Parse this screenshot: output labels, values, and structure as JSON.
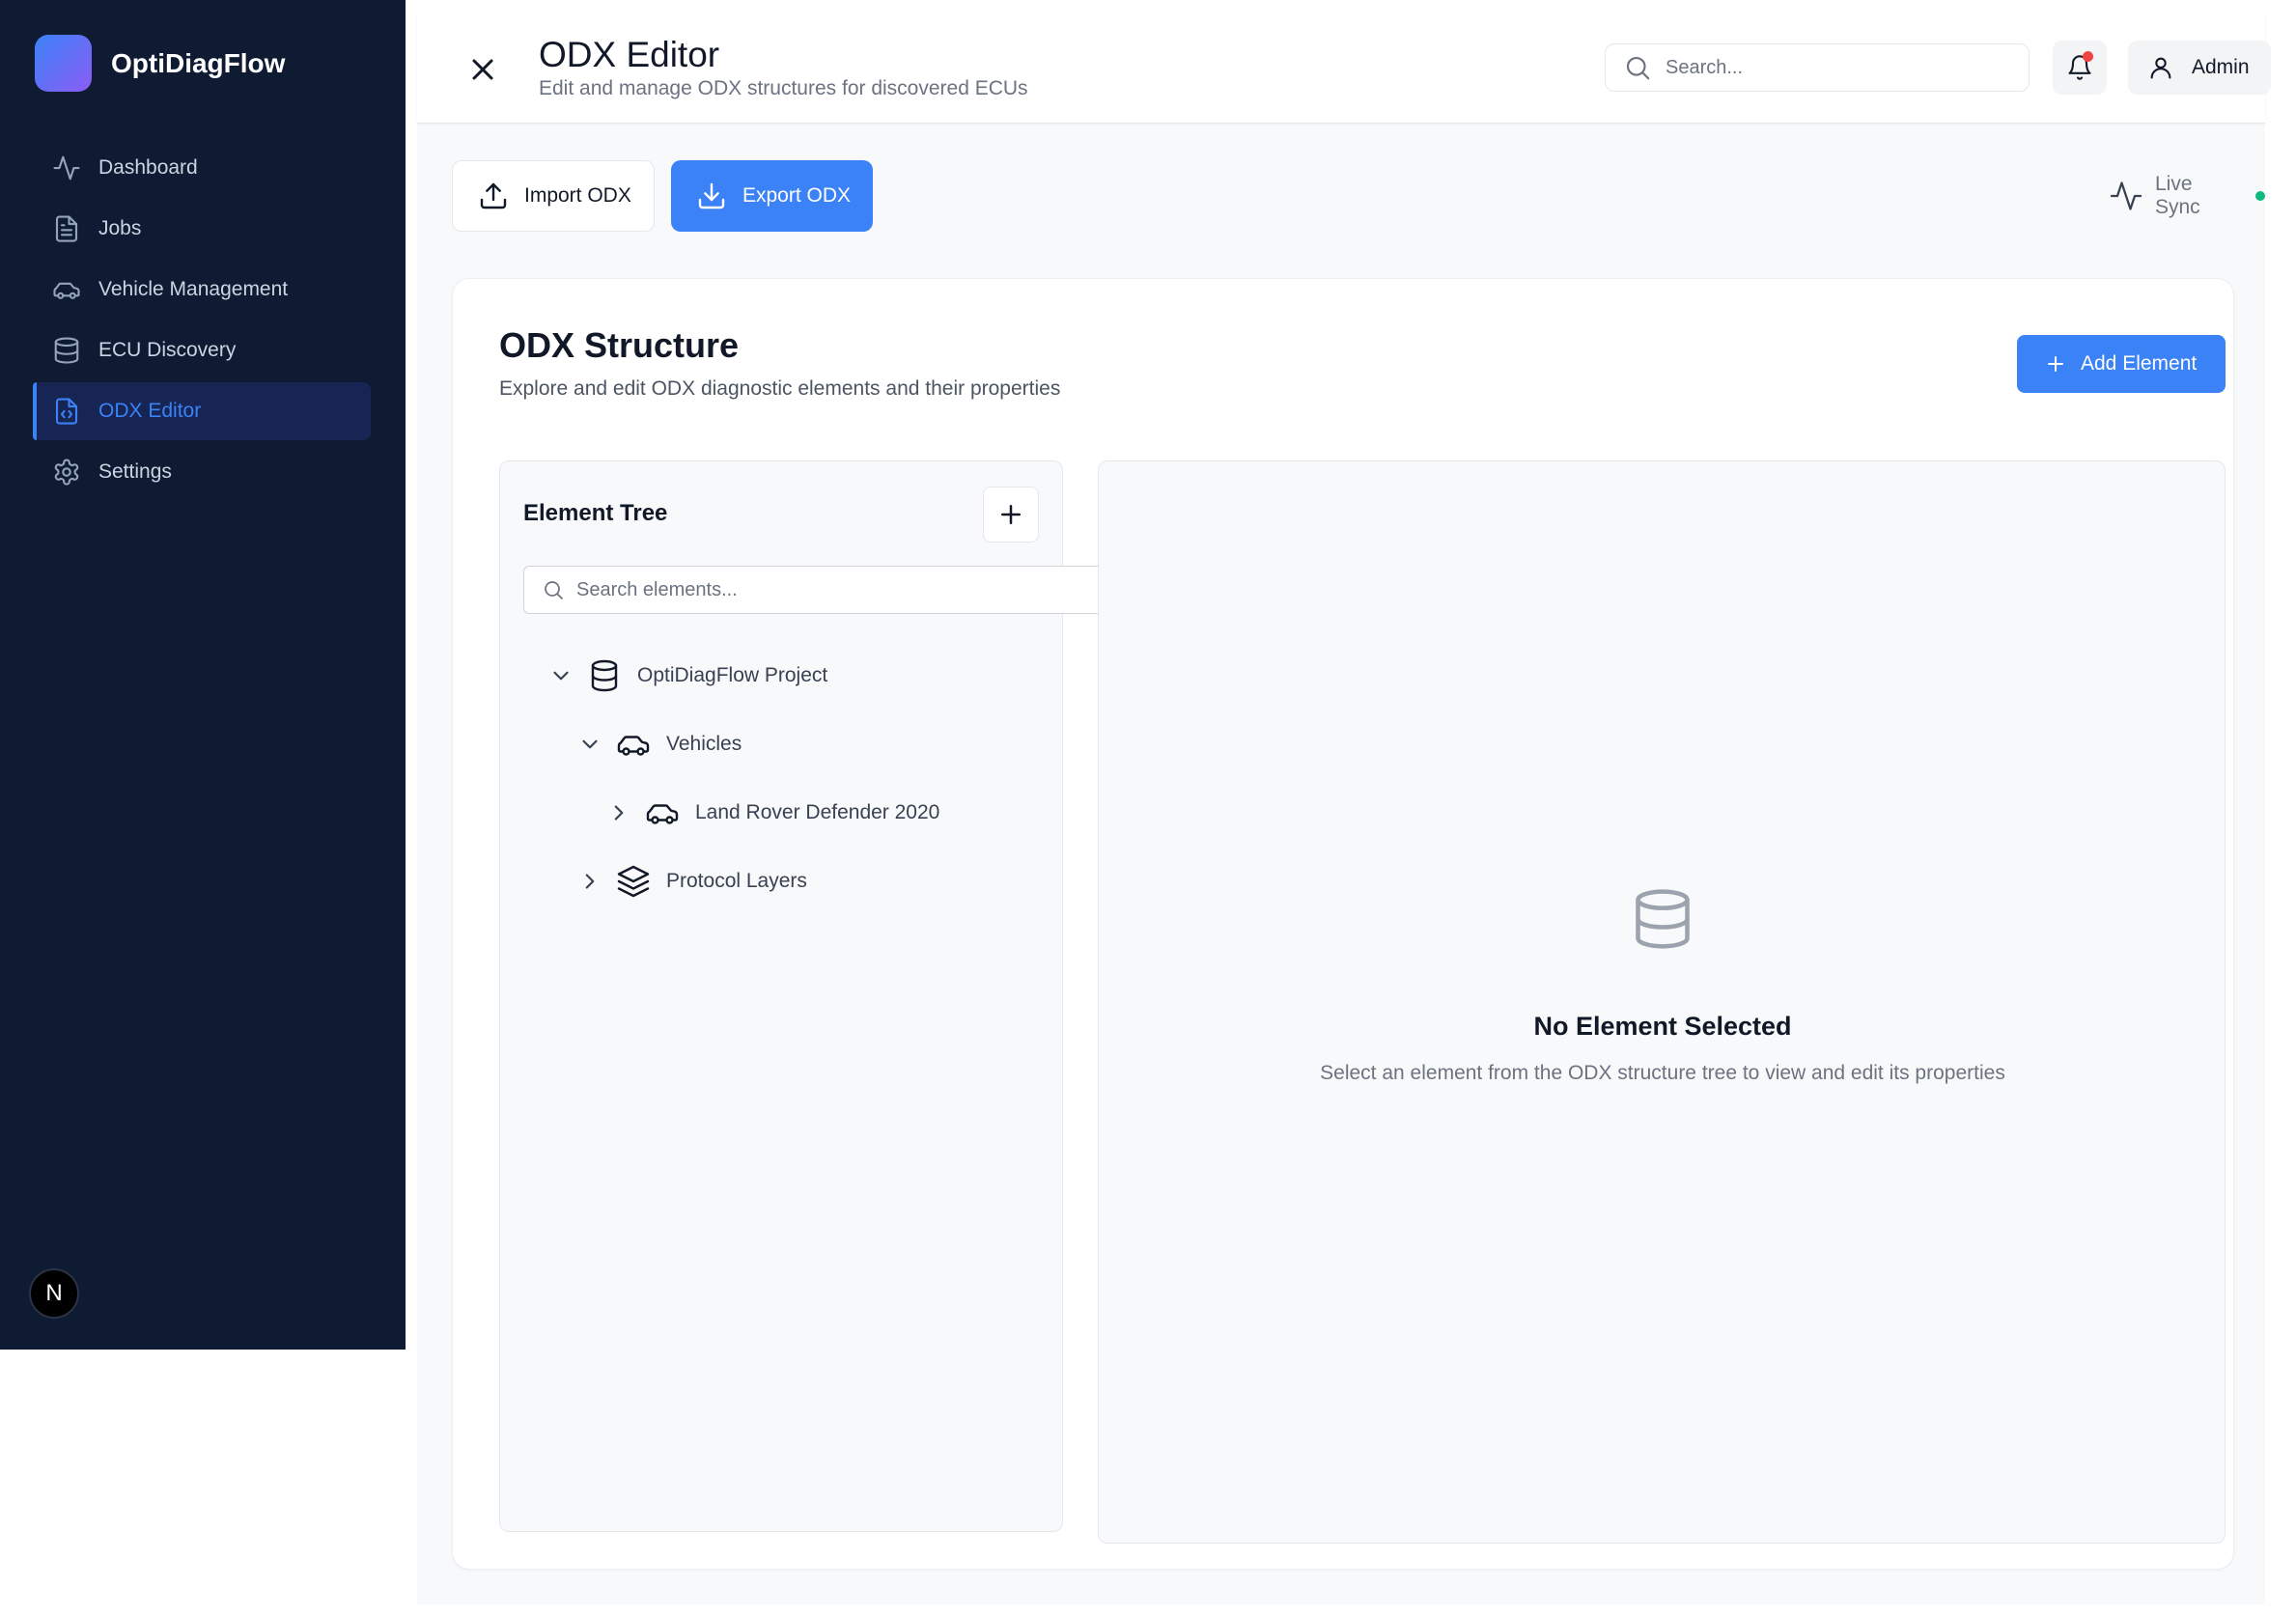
{
  "app": {
    "name": "OptiDiagFlow"
  },
  "sidebar": {
    "items": [
      {
        "label": "Dashboard",
        "icon": "activity-icon",
        "active": false
      },
      {
        "label": "Jobs",
        "icon": "document-icon",
        "active": false
      },
      {
        "label": "Vehicle Management",
        "icon": "car-icon",
        "active": false
      },
      {
        "label": "ECU Discovery",
        "icon": "database-icon",
        "active": false
      },
      {
        "label": "ODX Editor",
        "icon": "code-file-icon",
        "active": true
      },
      {
        "label": "Settings",
        "icon": "gear-icon",
        "active": false
      }
    ],
    "avatar_letter": "N"
  },
  "header": {
    "title": "ODX Editor",
    "subtitle": "Edit and manage ODX structures for discovered ECUs",
    "search_placeholder": "Search...",
    "user_label": "Admin",
    "has_notification": true
  },
  "toolbar": {
    "import_label": "Import ODX",
    "export_label": "Export ODX",
    "live_sync_label": "Live Sync",
    "live_sync_status_color": "#10b981"
  },
  "structure": {
    "title": "ODX Structure",
    "subtitle": "Explore and edit ODX diagnostic elements and their properties",
    "add_element_label": "Add Element",
    "tree": {
      "title": "Element Tree",
      "search_placeholder": "Search elements...",
      "nodes": [
        {
          "label": "OptiDiagFlow Project",
          "icon": "database-icon",
          "expanded": true,
          "level": 0
        },
        {
          "label": "Vehicles",
          "icon": "car-icon",
          "expanded": true,
          "level": 1
        },
        {
          "label": "Land Rover Defender 2020",
          "icon": "car-icon",
          "expanded": false,
          "level": 2
        },
        {
          "label": "Protocol Layers",
          "icon": "layers-icon",
          "expanded": false,
          "level": 1
        }
      ]
    },
    "detail": {
      "empty_title": "No Element Selected",
      "empty_subtitle": "Select an element from the ODX structure tree to view and edit its properties"
    }
  },
  "colors": {
    "sidebar_bg": "#0f1a33",
    "accent": "#3b82f6",
    "notification_dot": "#ef4444"
  }
}
